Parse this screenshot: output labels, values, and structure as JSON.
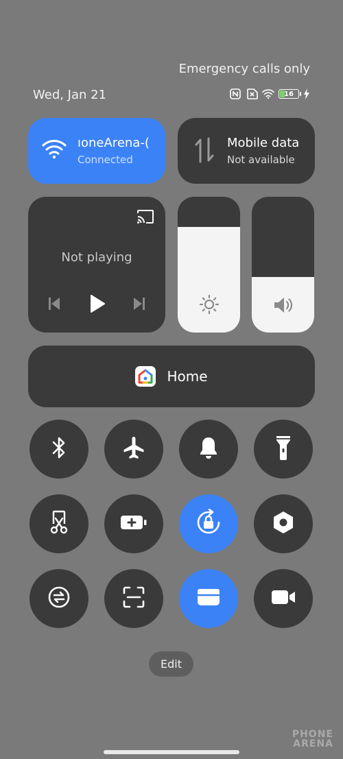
{
  "status_bar": {
    "carrier_text": "Emergency calls only",
    "date": "Wed, Jan 21",
    "battery_level": "16",
    "icons": [
      "nfc-icon",
      "no-sim-icon",
      "wifi-icon",
      "battery-icon",
      "charging-icon"
    ]
  },
  "tiles": {
    "wifi": {
      "title": "ıoneArena-(",
      "subtitle": "Connected",
      "active": true
    },
    "mobile_data": {
      "title": "Mobile data",
      "subtitle": "Not available",
      "active": false
    }
  },
  "media": {
    "status": "Not playing",
    "icons": [
      "cast-icon",
      "previous-icon",
      "play-icon",
      "next-icon"
    ]
  },
  "sliders": {
    "brightness": {
      "level": 0.78,
      "icon": "sun-icon"
    },
    "volume": {
      "level": 0.41,
      "icon": "speaker-icon"
    }
  },
  "home_control": {
    "label": "Home",
    "icon": "google-home-icon"
  },
  "toggles": [
    {
      "name": "bluetooth",
      "icon": "bluetooth-icon",
      "active": false
    },
    {
      "name": "airplane-mode",
      "icon": "airplane-icon",
      "active": false
    },
    {
      "name": "sound",
      "icon": "bell-icon",
      "active": false
    },
    {
      "name": "flashlight",
      "icon": "flashlight-icon",
      "active": false
    },
    {
      "name": "screenshot",
      "icon": "scissors-icon",
      "active": false
    },
    {
      "name": "battery-saver",
      "icon": "battery-plus-icon",
      "active": false
    },
    {
      "name": "rotation-lock",
      "icon": "rotation-lock-icon",
      "active": true
    },
    {
      "name": "settings",
      "icon": "hexagon-icon",
      "active": false
    },
    {
      "name": "sync",
      "icon": "sync-icon",
      "active": false
    },
    {
      "name": "scanner",
      "icon": "scan-icon",
      "active": false
    },
    {
      "name": "wallet",
      "icon": "wallet-icon",
      "active": true
    },
    {
      "name": "video",
      "icon": "video-camera-icon",
      "active": false
    }
  ],
  "edit_label": "Edit",
  "watermark": {
    "line1": "PHONE",
    "line2": "ARENA"
  },
  "colors": {
    "background": "#7a7a7a",
    "tile": "#3a3a3a",
    "accent": "#3b82f6"
  }
}
